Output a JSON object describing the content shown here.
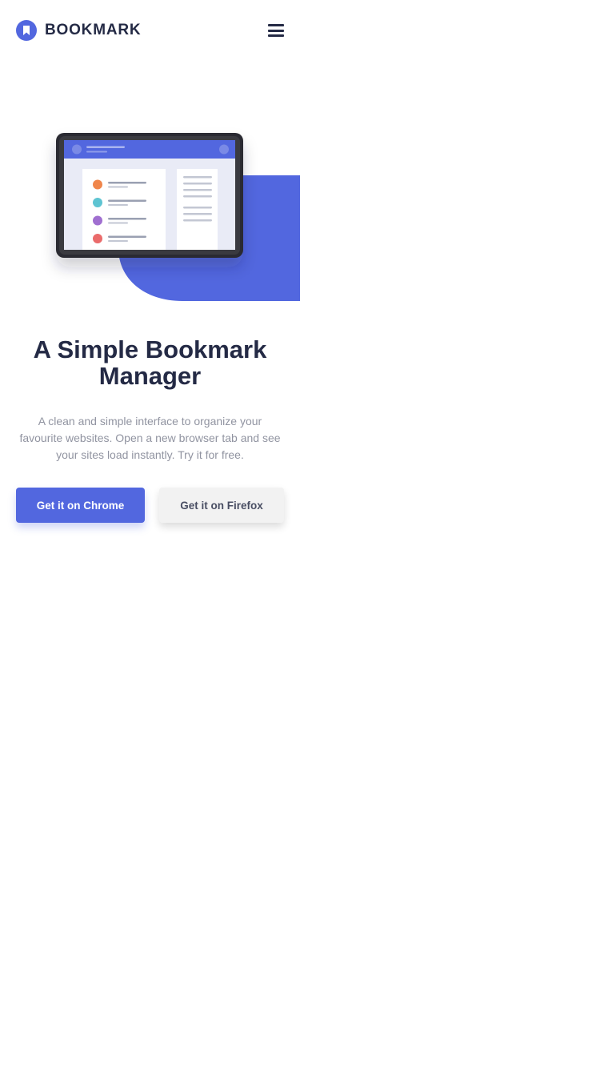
{
  "brand": {
    "name": "BOOKMARK",
    "logo_icon": "bookmark-icon"
  },
  "nav": {
    "menu_icon": "hamburger-menu-icon"
  },
  "hero": {
    "illustration": "tablet-bookmark-illustration",
    "title": "A Simple Bookmark Manager",
    "description": "A clean and simple interface to organize your favourite websites. Open a new browser tab and see your sites load instantly. Try it for free.",
    "buttons": {
      "chrome_label": "Get it on Chrome",
      "firefox_label": "Get it on Firefox"
    }
  },
  "colors": {
    "primary": "#5267df",
    "dark_text": "#242a45",
    "muted_text": "#9194a1",
    "secondary_button": "#f2f2f2",
    "bookmark_orange": "#f0864b",
    "bookmark_teal": "#5ec4d2",
    "bookmark_purple": "#a06fd0",
    "bookmark_red": "#ea6b6b"
  }
}
